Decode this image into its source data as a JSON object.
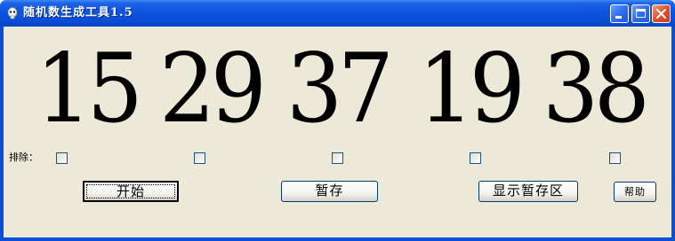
{
  "window": {
    "title": "随机数生成工具1.5",
    "controls": {
      "minimize": "minimize-icon",
      "maximize": "maximize-icon",
      "close": "close-icon"
    }
  },
  "numbers": [
    "15",
    "29",
    "37",
    "19",
    "38"
  ],
  "exclude": {
    "label": "排除：",
    "checkboxes": [
      false,
      false,
      false,
      false,
      false
    ]
  },
  "buttons": {
    "start": "开始",
    "save": "暂存",
    "show_saved": "显示暂存区",
    "help": "帮助"
  },
  "colors": {
    "titlebar": "#0a4fd8",
    "client": "#ece9d8",
    "close_button": "#e0502a"
  }
}
